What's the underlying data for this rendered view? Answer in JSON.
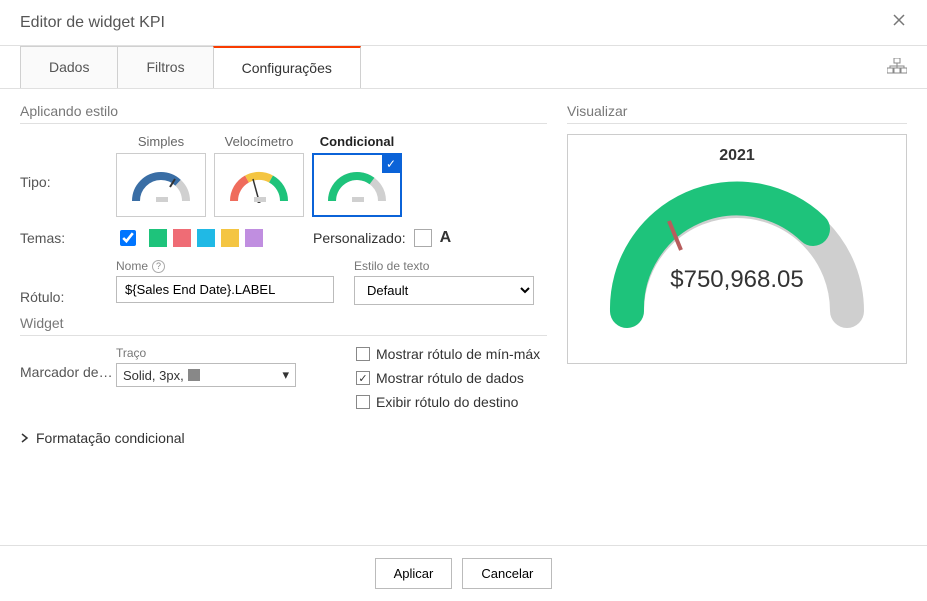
{
  "header": {
    "title": "Editor de widget KPI"
  },
  "tabs": {
    "data": "Dados",
    "filters": "Filtros",
    "settings": "Configurações"
  },
  "styling": {
    "section_title": "Aplicando estilo",
    "type_label": "Tipo:",
    "types": {
      "simple": "Simples",
      "speedo": "Velocímetro",
      "conditional": "Condicional"
    },
    "themes_label": "Temas:",
    "swatches": [
      "#1ec37b",
      "#ef6c75",
      "#20b9e5",
      "#f4c542",
      "#c08ee0"
    ],
    "custom_label": "Personalizado:",
    "name_label": "Nome",
    "name_value": "${Sales End Date}.LABEL",
    "rotulo_label": "Rótulo:",
    "textstyle_label": "Estilo de texto",
    "textstyle_value": "Default"
  },
  "widget": {
    "section_title": "Widget",
    "stroke_label": "Traço",
    "marker_label": "Marcador de d...",
    "stroke_value": "Solid, 3px,",
    "checks": {
      "minmax": "Mostrar rótulo de mín-máx",
      "datalabel": "Mostrar rótulo de dados",
      "target": "Exibir rótulo do destino"
    }
  },
  "conditional": {
    "expand_label": "Formatação condicional"
  },
  "preview": {
    "section_title": "Visualizar",
    "year": "2021",
    "value": "$750,968.05",
    "gauge_colors": {
      "fill": "#1ec37b",
      "bg": "#cfcfcf",
      "tick": "#b85c5c"
    }
  },
  "footer": {
    "apply": "Aplicar",
    "cancel": "Cancelar"
  }
}
